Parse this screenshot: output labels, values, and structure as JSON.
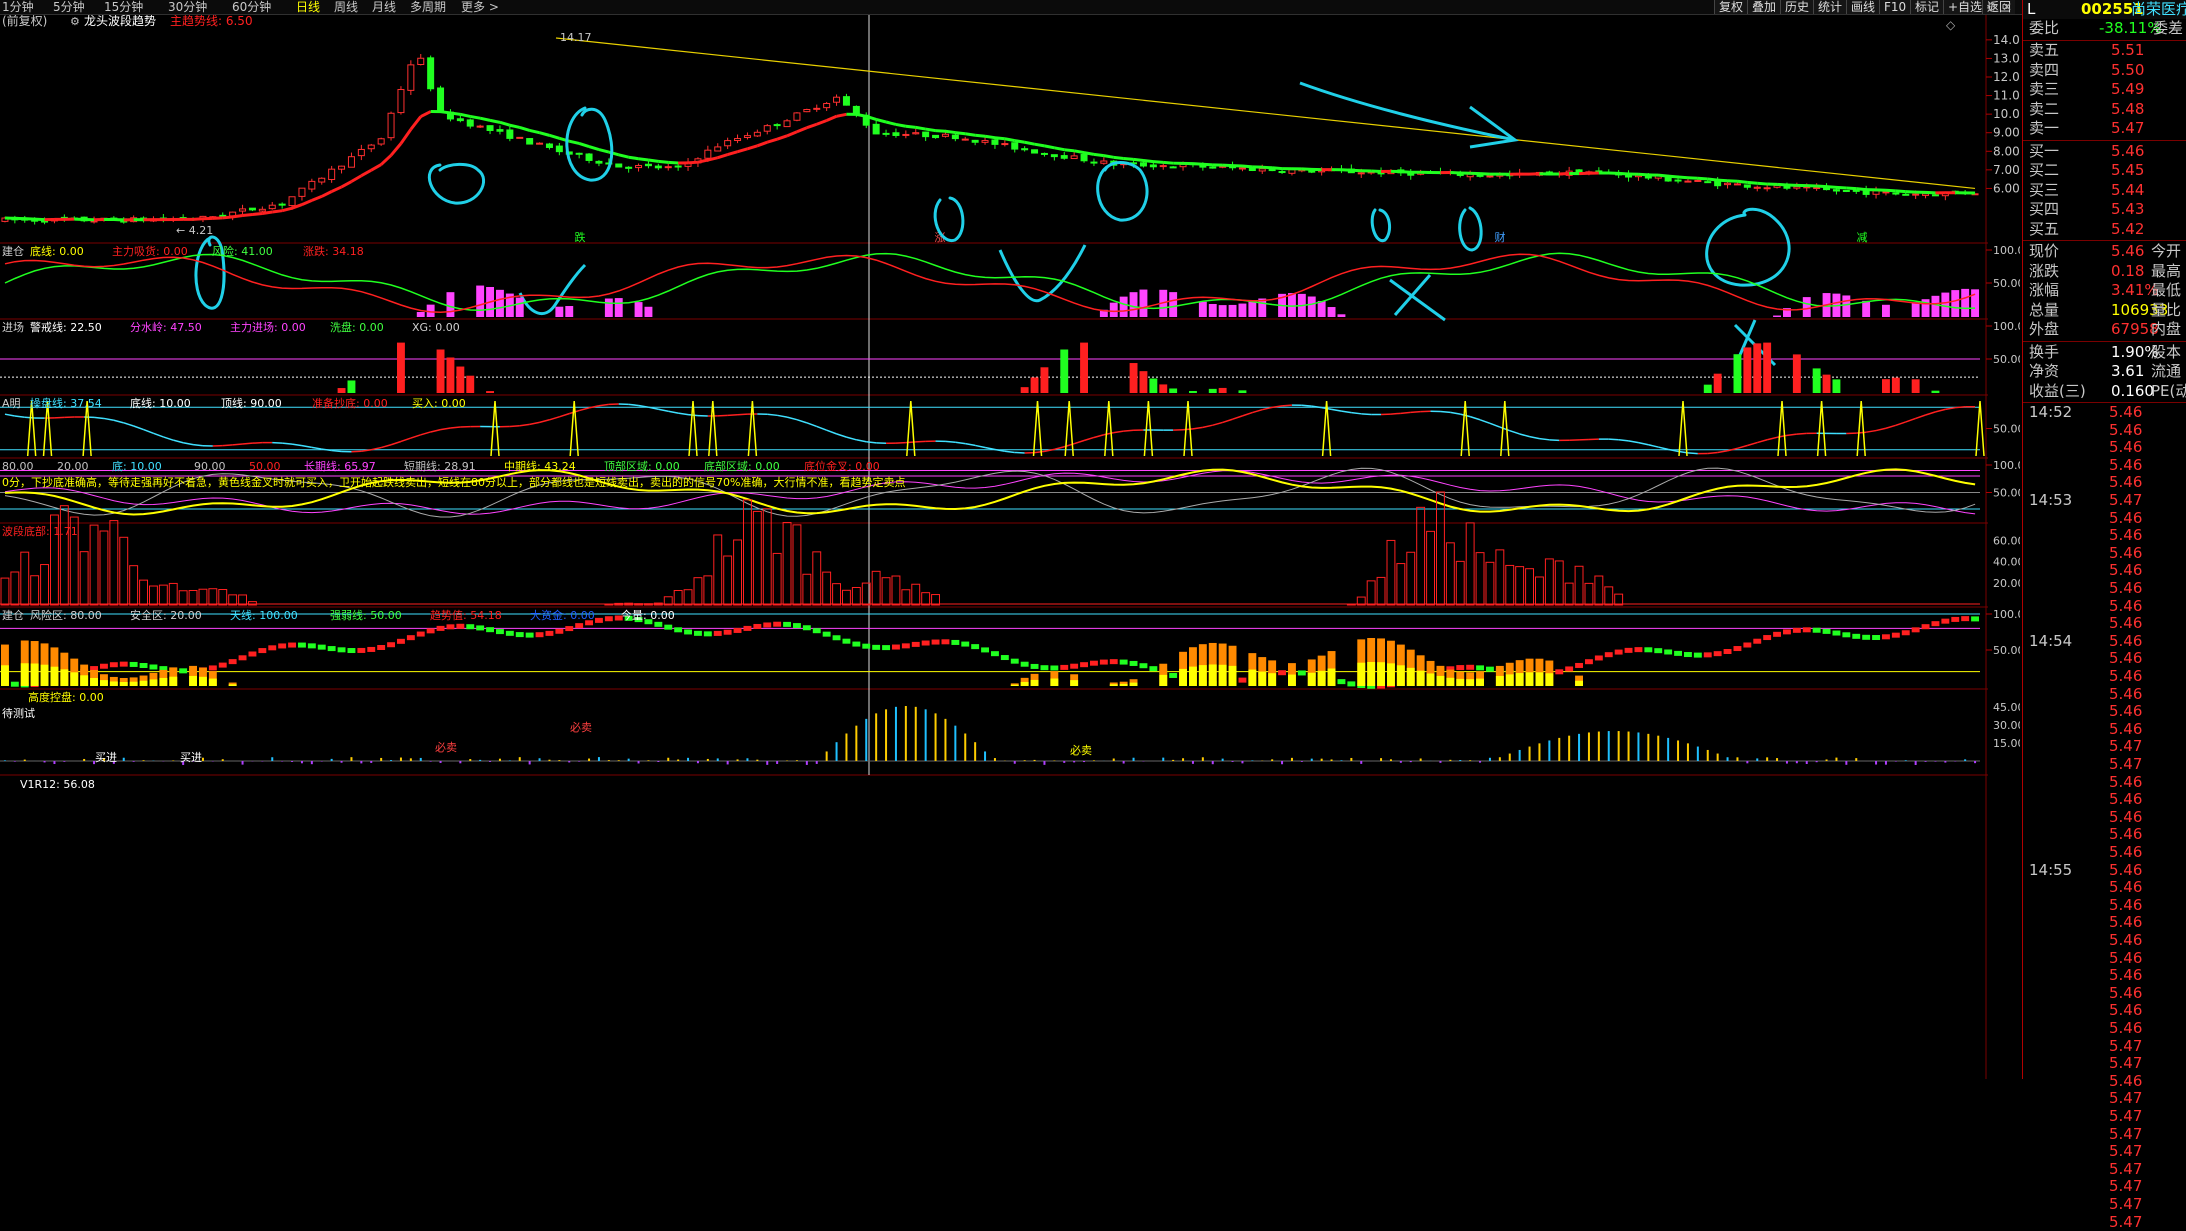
{
  "toolbar": {
    "periods": [
      "1分钟",
      "5分钟",
      "15分钟",
      "30分钟",
      "60分钟",
      "日线",
      "周线",
      "月线",
      "多周期",
      "更多 >"
    ],
    "active_period": "日线",
    "right_buttons": [
      "复权",
      "叠加",
      "历史",
      "统计",
      "画线",
      "F10",
      "标记",
      "+自选",
      "返回"
    ]
  },
  "main_chart": {
    "title_prefix": "(前复权)",
    "indicator_name": "龙头波段趋势",
    "indicator_value": "主趋势线: 6.50",
    "high_label": "14.17",
    "low_label": "4.21",
    "y_ticks": [
      "14.00",
      "13.00",
      "12.00",
      "11.00",
      "10.00",
      "9.00",
      "8.00",
      "7.00",
      "6.00"
    ],
    "markers": [
      "跌",
      "涨",
      "财",
      "减"
    ]
  },
  "pane2": {
    "labels": [
      {
        "t": "建仓",
        "c": "#d0d0d0"
      },
      {
        "t": "底线: 0.00",
        "c": "#ffff00"
      },
      {
        "t": "主力吸货: 0.00",
        "c": "#ff2020"
      },
      {
        "t": "风险: 41.00",
        "c": "#40ff40"
      },
      {
        "t": "涨跌: 34.18",
        "c": "#ff2020"
      }
    ],
    "y_ticks": [
      "100.0",
      "50.00"
    ]
  },
  "pane3": {
    "labels": [
      {
        "t": "进场",
        "c": "#d0d0d0"
      },
      {
        "t": "警戒线: 22.50",
        "c": "#ffffff"
      },
      {
        "t": "分水岭: 47.50",
        "c": "#ff44ff"
      },
      {
        "t": "主力进场: 0.00",
        "c": "#ff44ff"
      },
      {
        "t": "洗盘: 0.00",
        "c": "#40ff40"
      },
      {
        "t": "XG: 0.00",
        "c": "#d0d0d0"
      }
    ],
    "y_ticks": [
      "100.0",
      "50.00"
    ]
  },
  "pane4": {
    "labels": [
      {
        "t": "A明",
        "c": "#d0d0d0"
      },
      {
        "t": "操盘线: 37.54",
        "c": "#40e0ff"
      },
      {
        "t": "底线: 10.00",
        "c": "#ffffff"
      },
      {
        "t": "顶线: 90.00",
        "c": "#ffffff"
      },
      {
        "t": "准备抄底: 0.00",
        "c": "#ff2020"
      },
      {
        "t": "买入: 0.00",
        "c": "#ffff00"
      }
    ],
    "y_ticks": [
      "50.00"
    ]
  },
  "pane5": {
    "labels": [
      {
        "t": "80.00",
        "c": "#c0c0c0"
      },
      {
        "t": "20.00",
        "c": "#c0c0c0"
      },
      {
        "t": "底: 10.00",
        "c": "#40e0ff"
      },
      {
        "t": "90.00",
        "c": "#c0c0c0"
      },
      {
        "t": "50.00",
        "c": "#ff2020"
      },
      {
        "t": "长期线: 65.97",
        "c": "#ff44ff"
      },
      {
        "t": "短期线: 28.91",
        "c": "#c0c0c0"
      },
      {
        "t": "中期线: 43.24",
        "c": "#ffff00"
      },
      {
        "t": "顶部区域: 0.00",
        "c": "#40ff40"
      },
      {
        "t": "底部区域: 0.00",
        "c": "#40ff40"
      },
      {
        "t": "底位金叉: 0.00",
        "c": "#ff2020"
      }
    ],
    "note": "0分，下抄底准确高，等待走强再好不着急，黄色线金叉时就可买入，卫开始起跌线卖出，短线在80分以上，部分都线也是短线卖出，卖出的的信号70%准确，大行情不准，看趋势定卖点",
    "y_ticks": [
      "100.0",
      "50.00"
    ]
  },
  "pane6": {
    "labels": [
      {
        "t": "波段底部: 1.71",
        "c": "#ff2020"
      }
    ],
    "y_ticks": [
      "60.00",
      "40.00",
      "20.00"
    ]
  },
  "pane7": {
    "labels": [
      {
        "t": "建仓",
        "c": "#d0d0d0"
      },
      {
        "t": "风险区: 80.00",
        "c": "#d0d0d0"
      },
      {
        "t": "安全区: 20.00",
        "c": "#d0d0d0"
      },
      {
        "t": "天线: 100.00",
        "c": "#40e0ff"
      },
      {
        "t": "强弱线: 50.00",
        "c": "#40ff40"
      },
      {
        "t": "趋势值: 54.18",
        "c": "#ff2020"
      },
      {
        "t": "大资金: 0.00",
        "c": "#2060ff"
      },
      {
        "t": "今量: 0.00",
        "c": "#ffffff"
      }
    ],
    "y_ticks": [
      "100.0",
      "50.00"
    ]
  },
  "pane8": {
    "labels": [
      {
        "t": "高度控盘: 0.00",
        "c": "#ffff00"
      }
    ],
    "label2": "待测试",
    "sell_label": "必卖",
    "buy_label": "买进",
    "bottom_label": "V1R12: 56.08",
    "y_ticks": [
      "45.00",
      "30.00",
      "15.00"
    ]
  },
  "quote": {
    "code": "002551",
    "name": "尚荣医疗",
    "header_left": "L",
    "webi_label": "委比",
    "webi_value": "-38.11%",
    "webi_right": "委差",
    "asks": [
      {
        "l": "卖五",
        "p": "5.51"
      },
      {
        "l": "卖四",
        "p": "5.50"
      },
      {
        "l": "卖三",
        "p": "5.49"
      },
      {
        "l": "卖二",
        "p": "5.48"
      },
      {
        "l": "卖一",
        "p": "5.47"
      }
    ],
    "bids": [
      {
        "l": "买一",
        "p": "5.46"
      },
      {
        "l": "买二",
        "p": "5.45"
      },
      {
        "l": "买三",
        "p": "5.44"
      },
      {
        "l": "买四",
        "p": "5.43"
      },
      {
        "l": "买五",
        "p": "5.42"
      }
    ],
    "stats": [
      {
        "l": "现价",
        "v": "5.46",
        "r": "今开",
        "c": "#ff3030"
      },
      {
        "l": "涨跌",
        "v": "0.18",
        "r": "最高",
        "c": "#ff3030"
      },
      {
        "l": "涨幅",
        "v": "3.41%",
        "r": "最低",
        "c": "#ff3030"
      },
      {
        "l": "总量",
        "v": "106933",
        "r": "量比",
        "c": "#ffff00"
      },
      {
        "l": "外盘",
        "v": "67958",
        "r": "内盘",
        "c": "#ff3030"
      }
    ],
    "stats2": [
      {
        "l": "换手",
        "v": "1.90%",
        "r": "股本"
      },
      {
        "l": "净资",
        "v": "3.61",
        "r": "流通"
      },
      {
        "l": "收益(三)",
        "v": "0.160",
        "r": "PE(动"
      }
    ],
    "ticks": [
      {
        "t": "14:52",
        "p": "5.46"
      },
      {
        "t": "",
        "p": "5.46"
      },
      {
        "t": "",
        "p": "5.46"
      },
      {
        "t": "",
        "p": "5.46"
      },
      {
        "t": "",
        "p": "5.46"
      },
      {
        "t": "14:53",
        "p": "5.47"
      },
      {
        "t": "",
        "p": "5.46"
      },
      {
        "t": "",
        "p": "5.46"
      },
      {
        "t": "",
        "p": "5.46"
      },
      {
        "t": "",
        "p": "5.46"
      },
      {
        "t": "",
        "p": "5.46"
      },
      {
        "t": "",
        "p": "5.46"
      },
      {
        "t": "",
        "p": "5.46"
      },
      {
        "t": "14:54",
        "p": "5.46"
      },
      {
        "t": "",
        "p": "5.46"
      },
      {
        "t": "",
        "p": "5.46"
      },
      {
        "t": "",
        "p": "5.46"
      },
      {
        "t": "",
        "p": "5.46"
      },
      {
        "t": "",
        "p": "5.46"
      },
      {
        "t": "",
        "p": "5.47"
      },
      {
        "t": "",
        "p": "5.47"
      },
      {
        "t": "",
        "p": "5.46"
      },
      {
        "t": "",
        "p": "5.46"
      },
      {
        "t": "",
        "p": "5.46"
      },
      {
        "t": "",
        "p": "5.46"
      },
      {
        "t": "",
        "p": "5.46"
      },
      {
        "t": "14:55",
        "p": "5.46"
      },
      {
        "t": "",
        "p": "5.46"
      },
      {
        "t": "",
        "p": "5.46"
      },
      {
        "t": "",
        "p": "5.46"
      },
      {
        "t": "",
        "p": "5.46"
      },
      {
        "t": "",
        "p": "5.46"
      },
      {
        "t": "",
        "p": "5.46"
      },
      {
        "t": "",
        "p": "5.46"
      },
      {
        "t": "",
        "p": "5.46"
      },
      {
        "t": "",
        "p": "5.46"
      },
      {
        "t": "",
        "p": "5.47"
      },
      {
        "t": "",
        "p": "5.47"
      },
      {
        "t": "",
        "p": "5.46"
      },
      {
        "t": "",
        "p": "5.47"
      },
      {
        "t": "",
        "p": "5.47"
      },
      {
        "t": "",
        "p": "5.47"
      },
      {
        "t": "",
        "p": "5.47"
      },
      {
        "t": "",
        "p": "5.47"
      },
      {
        "t": "",
        "p": "5.47"
      },
      {
        "t": "",
        "p": "5.47"
      },
      {
        "t": "",
        "p": "5.47"
      }
    ]
  },
  "colors": {
    "up": "#ff2020",
    "down": "#20ff20",
    "accent": "#ffff00",
    "cyan": "#40e0ff",
    "magenta": "#ff44ff",
    "bg": "#000000"
  }
}
